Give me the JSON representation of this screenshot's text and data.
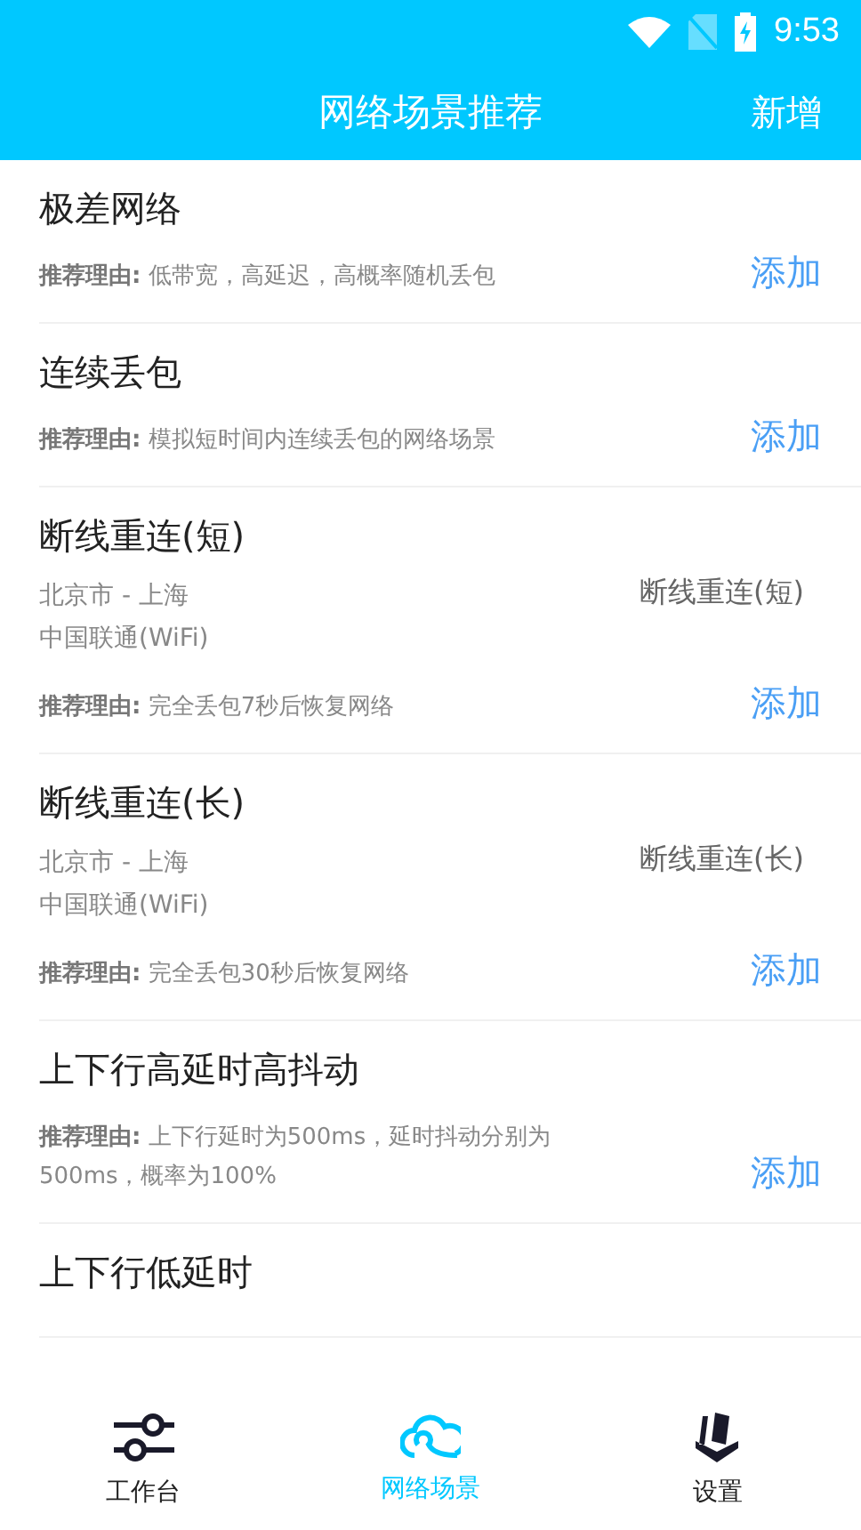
{
  "status_bar": {
    "time": "9:53"
  },
  "header": {
    "title": "网络场景推荐",
    "action": "新增"
  },
  "scenarios": [
    {
      "kind": "simple",
      "title": "极差网络",
      "reason_label": "推荐理由:",
      "reason": "低带宽，高延迟，高概率随机丢包",
      "add": "添加"
    },
    {
      "kind": "simple",
      "title": "连续丢包",
      "reason_label": "推荐理由:",
      "reason": "模拟短时间内连续丢包的网络场景",
      "add": "添加"
    },
    {
      "kind": "detailed",
      "title": "断线重连(短)",
      "route": "北京市 - 上海",
      "carrier": "中国联通(WiFi)",
      "tag": "断线重连(短)",
      "reason_label": "推荐理由:",
      "reason": "完全丢包7秒后恢复网络",
      "add": "添加"
    },
    {
      "kind": "detailed",
      "title": "断线重连(长)",
      "route": "北京市 - 上海",
      "carrier": "中国联通(WiFi)",
      "tag": "断线重连(长)",
      "reason_label": "推荐理由:",
      "reason": "完全丢包30秒后恢复网络",
      "add": "添加"
    },
    {
      "kind": "simple",
      "title": "上下行高延时高抖动",
      "reason_label": "推荐理由:",
      "reason": "上下行延时为500ms，延时抖动分别为500ms，概率为100%",
      "add": "添加"
    },
    {
      "kind": "title_only",
      "title": "上下行低延时"
    }
  ],
  "nav": [
    {
      "kind": "workbench",
      "label": "工作台",
      "selected": false
    },
    {
      "kind": "scenes",
      "label": "网络场景",
      "selected": true
    },
    {
      "kind": "settings",
      "label": "设置",
      "selected": false
    }
  ]
}
